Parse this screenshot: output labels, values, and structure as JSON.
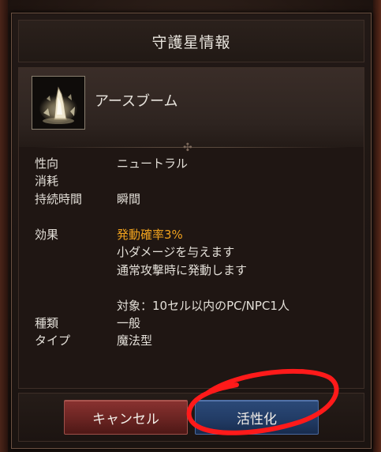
{
  "window": {
    "title": "守護星情報"
  },
  "skill": {
    "name": "アースブーム",
    "icon": "earth-boom-icon"
  },
  "details": {
    "tendency_label": "性向",
    "tendency_value": "ニュートラル",
    "consumption_label": "消耗",
    "consumption_value": "",
    "duration_label": "持続時間",
    "duration_value": "瞬間",
    "effect_label": "効果",
    "effect_lines": [
      "発動確率3%",
      "小ダメージを与えます",
      "通常攻撃時に発動します"
    ],
    "target_text": "対象：10セル以内のPC/NPC1人",
    "kind_label": "種類",
    "kind_value": "一般",
    "type_label": "タイプ",
    "type_value": "魔法型"
  },
  "buttons": {
    "cancel_label": "キャンセル",
    "activate_label": "活性化"
  },
  "colors": {
    "highlight": "#f0a21e",
    "cancel": "#6a2422",
    "activate": "#223c66",
    "annotation": "#ff1a1a"
  }
}
